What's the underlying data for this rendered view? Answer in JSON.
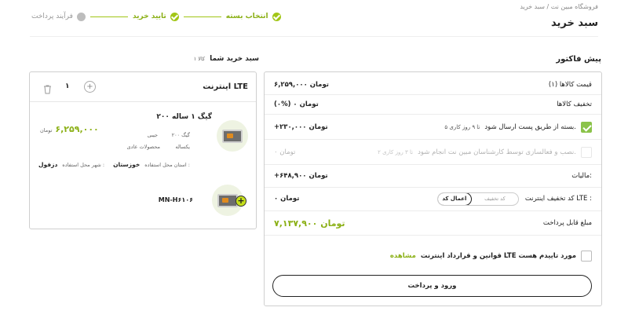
{
  "breadcrumb": {
    "text": "فروشگاه مبین نت / سبد خرید"
  },
  "page_title": "سبد خرید",
  "steps": [
    {
      "label": "انتخاب بسته",
      "status": "done"
    },
    {
      "label": "تایید خرید",
      "status": "done"
    },
    {
      "label": "فرآیند پرداخت",
      "status": "pending"
    }
  ],
  "invoice": {
    "title": "پیش فاکتور",
    "items_label": "قیمت کالاها (۱)",
    "items_value": "۶,۲۵۹,۰۰۰ تومان",
    "discount_label": "تخفیف کالاها",
    "discount_value": "(۰%) ۰ تومان",
    "shipping_label": "بسته از طریق پست ارسال شود.",
    "shipping_note": "۵ تا ۹ روز کاری",
    "shipping_value": "+۲۳۰,۰۰۰ تومان",
    "install_label": "نصب و فعالسازی توسط کارشناسان مبین نت انجام شود.",
    "install_note": "۲ تا ۳ روز کاری",
    "install_value": "۰ تومان",
    "tax_label": "مالیات:",
    "tax_value": "+۶۴۸,۹۰۰ تومان",
    "coupon_label": "کد تخفیف اینترنت LTE :",
    "coupon_placeholder": "کد تخفیف",
    "coupon_apply": "اعمال کد",
    "coupon_value": "۰ تومان",
    "payable_label": "مبلغ قابل پرداخت",
    "payable_value": "۷,۱۳۷,۹۰۰ تومان",
    "terms_text": "قوانین و قرارداد اینترنت LTE مورد تاییدم هست",
    "terms_link": "مشاهده",
    "login_pay": "ورود و پرداخت"
  },
  "cart": {
    "title": "سبد خرید شما",
    "count": "۱ کالا",
    "section_title": "اینترنت LTE",
    "quantity": "۱",
    "product_name": "۲۰۰ گیگ ۱ ساله",
    "spec_volume": "۲۰۰ گیگ",
    "spec_type": "جیبی",
    "spec_duration": "یکساله",
    "spec_category": "محصولات عادی",
    "price_value": "۶,۲۵۹,۰۰۰",
    "price_unit": "تومان",
    "province_label": "استان محل استفاده :",
    "province_value": "خوزستان",
    "city_label": "شهر محل استفاده :",
    "city_value": "دزفول",
    "modem_code": "MN-H۶۱۰۶"
  },
  "colors": {
    "accent": "#a2c617",
    "price_green": "#8bb016",
    "checkbox_green": "#8bc34a"
  }
}
